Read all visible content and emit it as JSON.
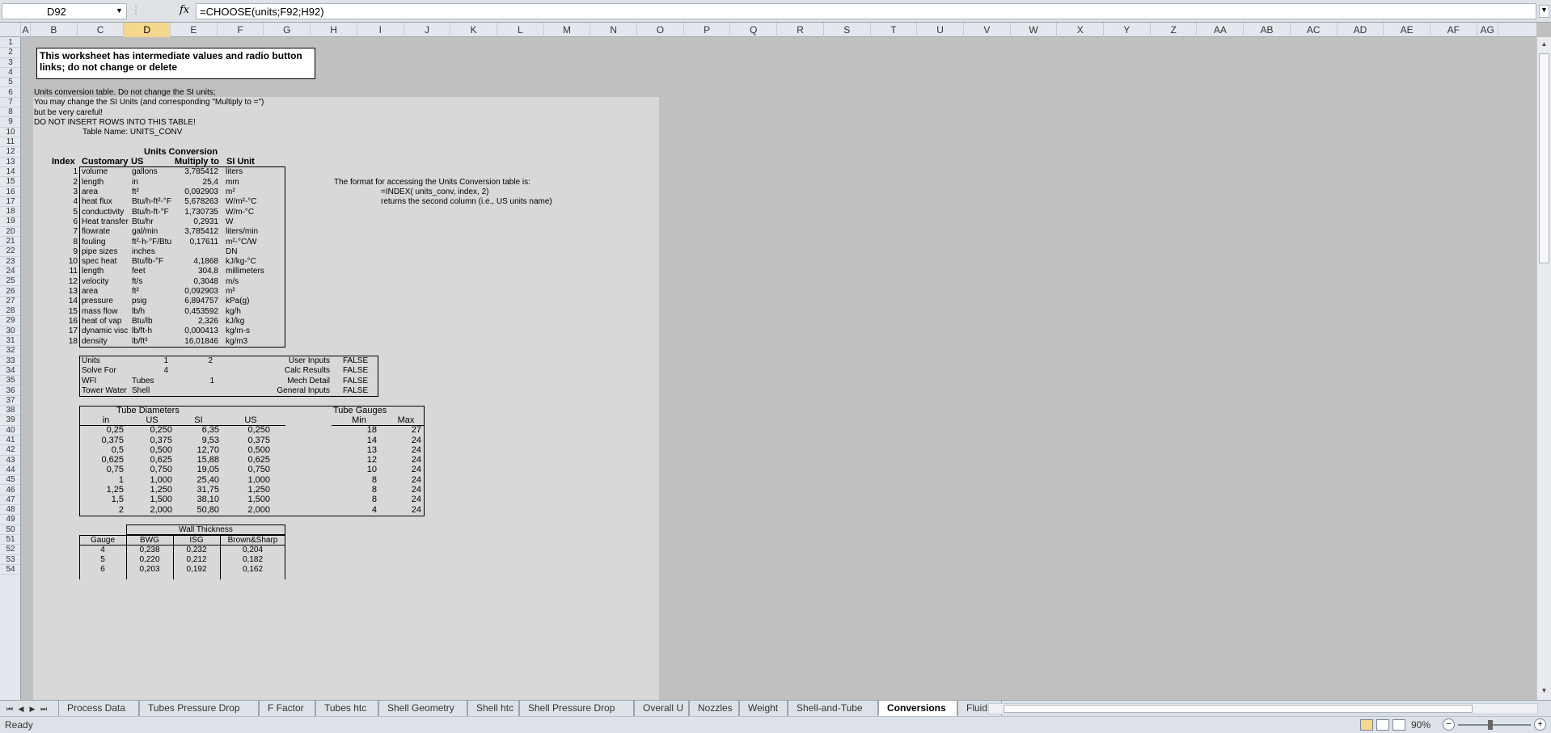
{
  "formula_bar": {
    "name_box": "D92",
    "fx": "fx",
    "formula": "=CHOOSE(units;F92;H92)"
  },
  "columns": [
    "A",
    "B",
    "C",
    "D",
    "E",
    "F",
    "G",
    "H",
    "I",
    "J",
    "K",
    "L",
    "M",
    "N",
    "O",
    "P",
    "Q",
    "R",
    "S",
    "T",
    "U",
    "V",
    "W",
    "X",
    "Y",
    "Z",
    "AA",
    "AB",
    "AC",
    "AD",
    "AE",
    "AF",
    "AG"
  ],
  "selected_column": "D",
  "rows_visible": 54,
  "sheet": {
    "note": "This worksheet has intermediate values and radio button links; do not change or delete",
    "intro": [
      "Units conversion table. Do not change the SI units;",
      "You may change the SI Units (and corresponding \"Multiply to =\")",
      "but be very careful!",
      "DO NOT INSERT ROWS INTO THIS TABLE!"
    ],
    "table_name": "Table Name: UNITS_CONV",
    "units_title": "Units Conversion",
    "units_headers": [
      "Index",
      "Customary",
      "US",
      "Multiply to",
      "SI Unit"
    ],
    "units_rows": [
      [
        "1",
        "volume",
        "gallons",
        "3,785412",
        "liters"
      ],
      [
        "2",
        "length",
        "in",
        "25,4",
        "mm"
      ],
      [
        "3",
        "area",
        "ft²",
        "0,092903",
        "m²"
      ],
      [
        "4",
        "heat flux",
        "Btu/h-ft²-°F",
        "5,678263",
        "W/m²-°C"
      ],
      [
        "5",
        "conductivity",
        "Btu/h-ft-°F",
        "1,730735",
        "W/m-°C"
      ],
      [
        "6",
        "Heat transfer",
        "Btu/hr",
        "0,2931",
        "W"
      ],
      [
        "7",
        "flowrate",
        "gal/min",
        "3,785412",
        "liters/min"
      ],
      [
        "8",
        "fouling",
        "ft²-h-°F/Btu",
        "0,17611",
        "m²-°C/W"
      ],
      [
        "9",
        "pipe sizes",
        "inches",
        "",
        "DN"
      ],
      [
        "10",
        "spec heat",
        "Btu/lb-°F",
        "4,1868",
        "kJ/kg-°C"
      ],
      [
        "11",
        "length",
        "feet",
        "304,8",
        "millimeters"
      ],
      [
        "12",
        "velocity",
        "ft/s",
        "0,3048",
        "m/s"
      ],
      [
        "13",
        "area",
        "ft²",
        "0,092903",
        "m²"
      ],
      [
        "14",
        "pressure",
        "psig",
        "6,894757",
        "kPa(g)"
      ],
      [
        "15",
        "mass flow",
        "lb/h",
        "0,453592",
        "kg/h"
      ],
      [
        "16",
        "heat of vap",
        "Btu/lb",
        "2,326",
        "kJ/kg"
      ],
      [
        "17",
        "dynamic visc",
        "lb/ft-h",
        "0,000413",
        "kg/m-s"
      ],
      [
        "18",
        "density",
        "lb/ft³",
        "16,01846",
        "kg/m3"
      ]
    ],
    "format_note": [
      "The format for accessing the Units Conversion table is:",
      "=INDEX( units_conv, index, 2)",
      "returns the second column (i.e., US units name)"
    ],
    "links_box": [
      {
        "label": "Units",
        "c1": "1",
        "c2": "2",
        "c3": "",
        "rlabel": "User Inputs",
        "rval": "FALSE"
      },
      {
        "label": "Solve For",
        "c1": "4",
        "c2": "",
        "c3": "",
        "rlabel": "Calc Results",
        "rval": "FALSE"
      },
      {
        "label": "WFI",
        "c1": "Tubes",
        "c2": "",
        "c3": "1",
        "rlabel": "Mech Detail",
        "rval": "FALSE"
      },
      {
        "label": "Tower Water",
        "c1": "Shell",
        "c2": "",
        "c3": "",
        "rlabel": "General Inputs",
        "rval": "FALSE"
      }
    ],
    "tube_diam_title": "Tube Diameters",
    "tube_diam_headers": [
      "in",
      "US",
      "SI",
      "US"
    ],
    "tube_diam_rows": [
      [
        "0,25",
        "0,250",
        "6,35",
        "0,250"
      ],
      [
        "0,375",
        "0,375",
        "9,53",
        "0,375"
      ],
      [
        "0,5",
        "0,500",
        "12,70",
        "0,500"
      ],
      [
        "0,625",
        "0,625",
        "15,88",
        "0,625"
      ],
      [
        "0,75",
        "0,750",
        "19,05",
        "0,750"
      ],
      [
        "1",
        "1,000",
        "25,40",
        "1,000"
      ],
      [
        "1,25",
        "1,250",
        "31,75",
        "1,250"
      ],
      [
        "1,5",
        "1,500",
        "38,10",
        "1,500"
      ],
      [
        "2",
        "2,000",
        "50,80",
        "2,000"
      ]
    ],
    "tube_gauges_title": "Tube Gauges",
    "tube_gauges_headers": [
      "Min",
      "Max"
    ],
    "tube_gauges_rows": [
      [
        "18",
        "27"
      ],
      [
        "14",
        "24"
      ],
      [
        "13",
        "24"
      ],
      [
        "12",
        "24"
      ],
      [
        "10",
        "24"
      ],
      [
        "8",
        "24"
      ],
      [
        "8",
        "24"
      ],
      [
        "8",
        "24"
      ],
      [
        "4",
        "24"
      ]
    ],
    "wall_title": "Wall Thickness",
    "wall_headers": [
      "Gauge",
      "BWG",
      "ISG",
      "Brown&Sharp"
    ],
    "wall_rows": [
      [
        "4",
        "0,238",
        "0,232",
        "0,204"
      ],
      [
        "5",
        "0,220",
        "0,212",
        "0,182"
      ],
      [
        "6",
        "0,203",
        "0,192",
        "0,162"
      ]
    ]
  },
  "tabs": [
    "Process Data",
    "Tubes Pressure Drop",
    "F Factor",
    "Tubes htc",
    "Shell Geometry",
    "Shell htc",
    "Shell Pressure Drop",
    "Overall U",
    "Nozzles",
    "Weight",
    "Shell-and-Tube",
    "Conversions",
    "Fluid Dat"
  ],
  "active_tab": "Conversions",
  "status": {
    "ready": "Ready",
    "zoom": "90%"
  }
}
